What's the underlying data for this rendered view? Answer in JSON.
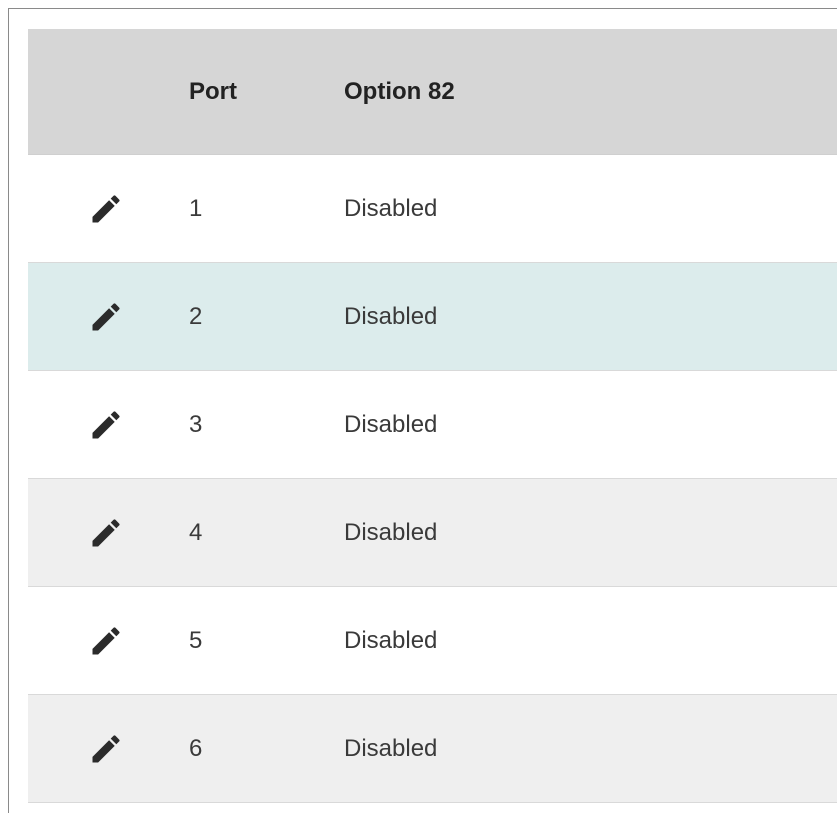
{
  "table": {
    "headers": {
      "edit": "",
      "port": "Port",
      "option82": "Option 82"
    },
    "rows": [
      {
        "port": "1",
        "option82": "Disabled",
        "edit_icon": "pencil-icon",
        "background": "#ffffff"
      },
      {
        "port": "2",
        "option82": "Disabled",
        "edit_icon": "pencil-icon",
        "background": "#dcecec"
      },
      {
        "port": "3",
        "option82": "Disabled",
        "edit_icon": "pencil-icon",
        "background": "#ffffff"
      },
      {
        "port": "4",
        "option82": "Disabled",
        "edit_icon": "pencil-icon",
        "background": "#efefef"
      },
      {
        "port": "5",
        "option82": "Disabled",
        "edit_icon": "pencil-icon",
        "background": "#ffffff"
      },
      {
        "port": "6",
        "option82": "Disabled",
        "edit_icon": "pencil-icon",
        "background": "#efefef"
      }
    ]
  },
  "colors": {
    "header_background": "#d6d6d6",
    "hover_row": "#dcecec",
    "striped_row": "#efefef",
    "icon": "#2b2b2b"
  }
}
